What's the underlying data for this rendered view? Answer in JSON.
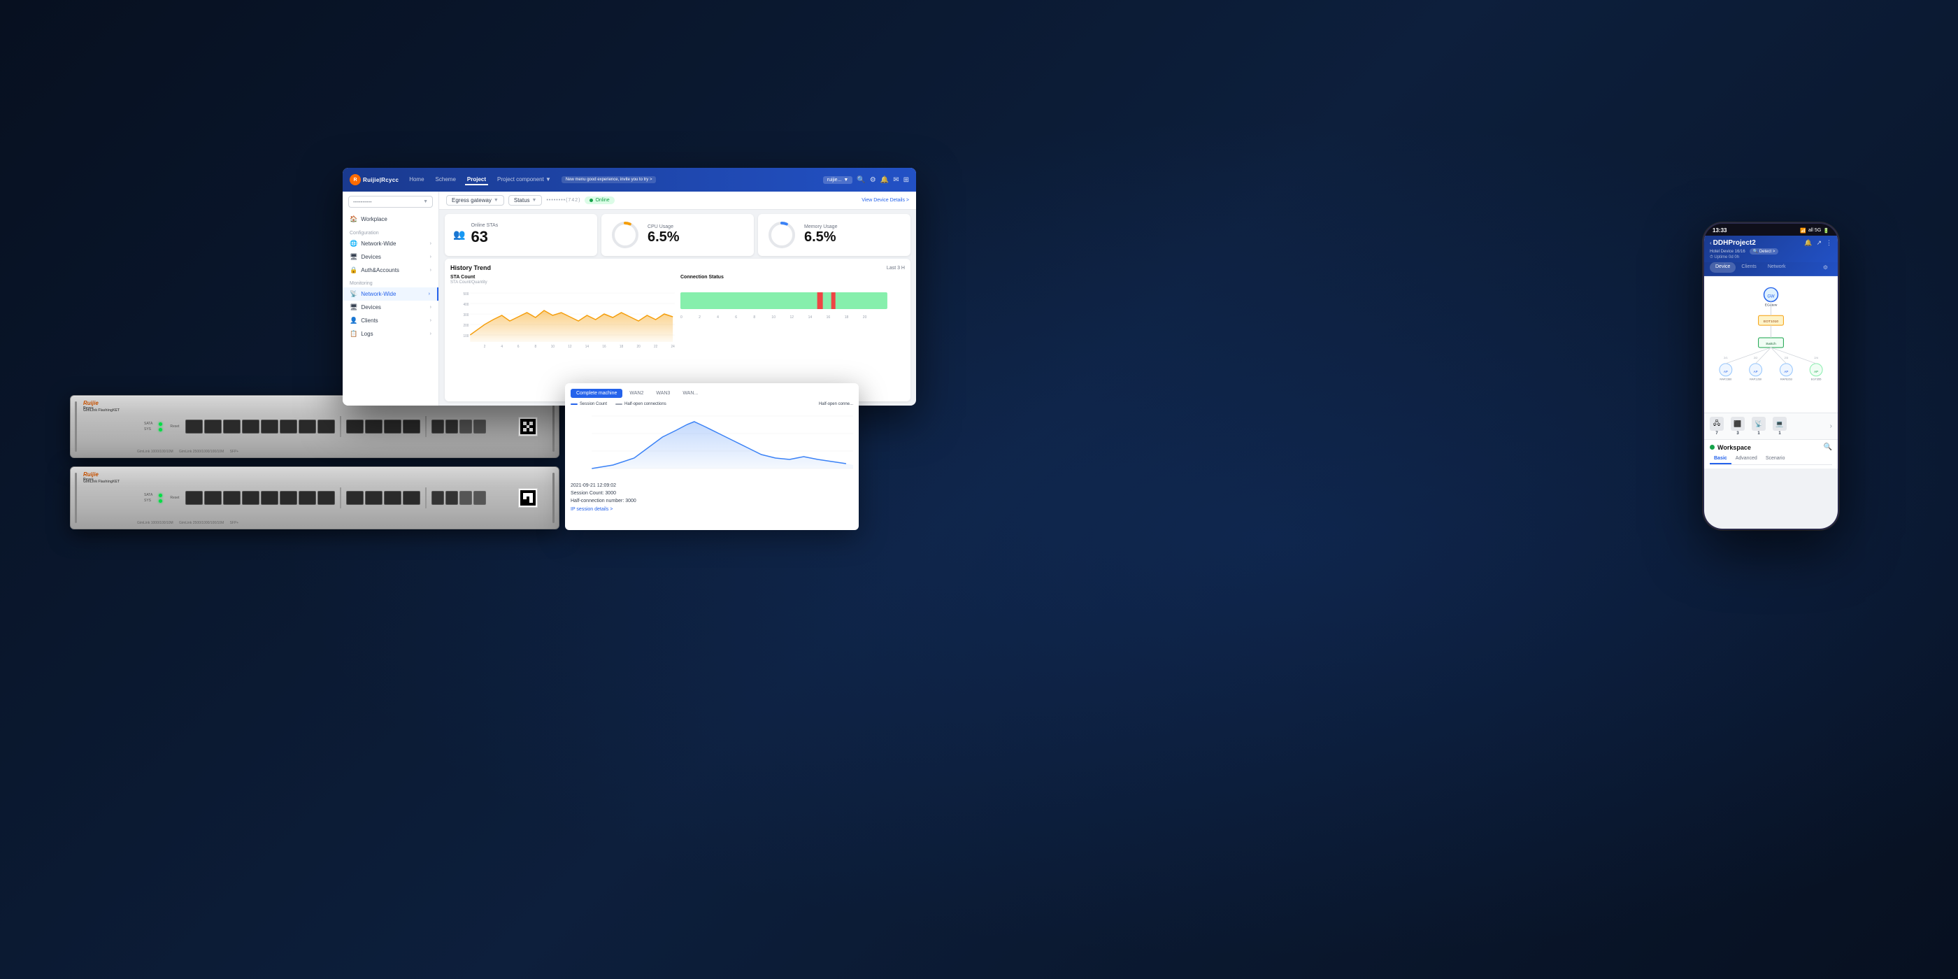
{
  "page": {
    "background": "#0a1628"
  },
  "nav": {
    "logo": "Ruijie|Rcycc",
    "items": [
      "Home",
      "Scheme",
      "Project",
      "Project component ▼"
    ],
    "active_item": "Project",
    "promo_text": "New menu good experience, invite you to try >",
    "user": "ruijie...",
    "icons": [
      "🔍",
      "🔔",
      "✉",
      "⚙"
    ]
  },
  "sidebar": {
    "dropdown_label": "----------",
    "sections": [
      {
        "label": "",
        "items": [
          {
            "name": "Workplace",
            "icon": "🏠"
          }
        ]
      },
      {
        "label": "Configuration",
        "items": [
          {
            "name": "Network-Wide",
            "icon": "🌐",
            "has_child": true
          },
          {
            "name": "Devices",
            "icon": "🖥",
            "has_child": true
          },
          {
            "name": "Auth&Accounts",
            "icon": "🔒",
            "has_child": true
          }
        ]
      },
      {
        "label": "Monitoring",
        "items": [
          {
            "name": "Network-Wide",
            "icon": "📡",
            "has_child": true,
            "active": true
          },
          {
            "name": "Devices",
            "icon": "🖥",
            "has_child": true
          },
          {
            "name": "Clients",
            "icon": "👤",
            "has_child": true
          },
          {
            "name": "Logs",
            "icon": "📋",
            "has_child": true
          }
        ]
      }
    ]
  },
  "device_bar": {
    "gateway_label": "Egress gateway",
    "status_label": "Status",
    "device_id": "••••••••(742)",
    "online_status": "Online",
    "view_details": "View Device Details >"
  },
  "stats": {
    "online_stas": {
      "label": "Online STAs",
      "value": "63"
    },
    "cpu_usage": {
      "label": "CPU Usage",
      "value": "6.5%",
      "percent": 6.5
    },
    "memory_usage": {
      "label": "Memory Usage",
      "value": "6.5%",
      "percent": 6.5
    }
  },
  "trend": {
    "title": "History Trend",
    "period": "Last 3 H",
    "sta_count": {
      "title": "STA Count",
      "subtitle": "STA Count/Quantity",
      "y_labels": [
        "500",
        "400",
        "300",
        "200",
        "100"
      ],
      "x_labels": [
        "2",
        "4",
        "6",
        "8",
        "10",
        "12",
        "14",
        "16",
        "18",
        "20",
        "22",
        "24"
      ]
    },
    "connection_status": {
      "title": "Connection Status",
      "x_labels": [
        "0",
        "2",
        "4",
        "6",
        "8",
        "10",
        "12",
        "14",
        "16",
        "18",
        "20"
      ]
    }
  },
  "connection_panel": {
    "tabs": [
      "Complete machine",
      "WAN2",
      "WAN3",
      "WAN..."
    ],
    "active_tab": "Complete machine",
    "legend": {
      "session_count": "Session Count",
      "half_open": "Half-open connections"
    },
    "half_open_label": "Half-open conne...",
    "timestamp": "2021-09-21 12:09:02",
    "session_count": "Session Count: 3000",
    "half_connection": "Half-connection number: 3000",
    "ip_session_link": "IP session details >"
  },
  "mobile": {
    "time": "13:33",
    "signal": "all 5G",
    "battery": "🔋",
    "project_title": "DDHProject2",
    "back_label": "< DDHProject2",
    "meta1": "Hotel  Device 16/16",
    "meta2": "⏱ Uptime 0d 0h",
    "detect_btn": "🔍 Detect >",
    "tabs": [
      "Device",
      "Clients",
      "Network"
    ],
    "tab_active": "Device",
    "topology_devices": {
      "gateway": "EGatew",
      "switch": "EOT1010",
      "switch2": "Switch",
      "aps": [
        "RAP2360",
        "RAP1260(2)",
        "RAP6263",
        "EGT355"
      ]
    },
    "device_counts": [
      "7",
      "3",
      "1",
      "1"
    ],
    "workspace_title": "Workspace",
    "workspace_tabs": [
      "Basic",
      "Advanced",
      "Scenario"
    ],
    "workspace_tab_active": "Basic"
  },
  "hardware": {
    "brand": "Ruijie Reyes",
    "model": "GimLink FlashingKET",
    "units": 2
  }
}
